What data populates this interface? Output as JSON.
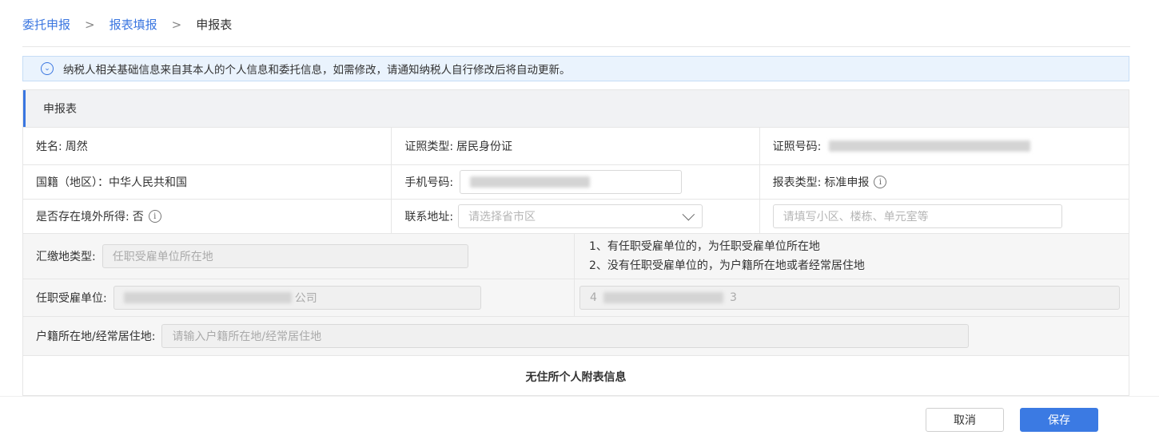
{
  "breadcrumb": {
    "items": [
      "委托申报",
      "报表填报",
      "申报表"
    ],
    "separator": ">"
  },
  "notice": {
    "text": "纳税人相关基础信息来自其本人的个人信息和委托信息，如需修改，请通知纳税人自行修改后将自动更新。"
  },
  "form": {
    "title": "申报表",
    "name_label": "姓名:",
    "name_value": "周然",
    "id_type_label": "证照类型:",
    "id_type_value": "居民身份证",
    "id_number_label": "证照号码:",
    "nationality": "国籍（地区）：中华人民共和国",
    "phone_label": "手机号码:",
    "report_type_label": "报表类型:",
    "report_type_value": "标准申报",
    "overseas_label": "是否存在境外所得:",
    "overseas_value": "否",
    "address_label": "联系地址:",
    "address_select_placeholder": "请选择省市区",
    "address_detail_placeholder": "请填写小区、楼栋、单元室等",
    "payment_location_label": "汇缴地类型:",
    "payment_location_value": "任职受雇单位所在地",
    "payment_note_1": "1、有任职受雇单位的，为任职受雇单位所在地",
    "payment_note_2": "2、没有任职受雇单位的，为户籍所在地或者经常居住地",
    "employer_label": "任职受雇单位:",
    "employer_value_suffix": "公司",
    "employer_id_prefix": "4",
    "employer_id_suffix": "3",
    "residence_label": "户籍所在地/经常居住地:",
    "residence_placeholder": "请输入户籍所在地/经常居住地",
    "nonresident_note": "无住所个人附表信息"
  },
  "buttons": {
    "cancel": "取消",
    "save": "保存"
  },
  "colors": {
    "accent": "#3a76e0",
    "notice_bg": "#eaf3fd"
  }
}
